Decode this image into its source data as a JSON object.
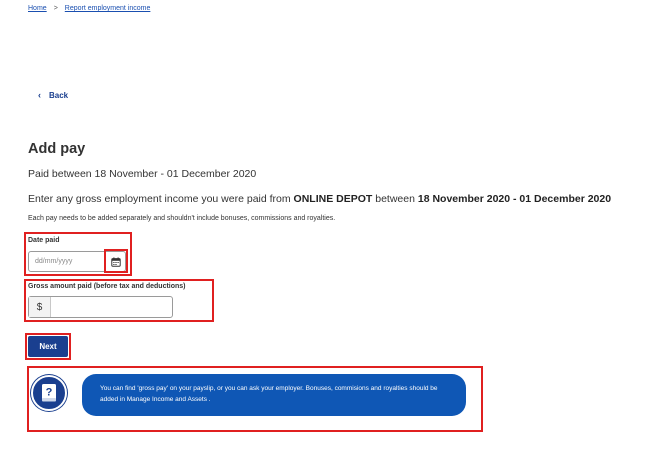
{
  "breadcrumb": {
    "items": [
      {
        "label": "Home"
      },
      {
        "label": "Report employment income"
      }
    ],
    "separator": ">"
  },
  "back": {
    "label": "Back"
  },
  "page": {
    "title": "Add pay",
    "subtitle": "Paid between 18 November - 01 December 2020",
    "intro_prefix": "Enter any gross employment income you were paid from",
    "employer": "ONLINE DEPOT",
    "intro_mid": "between",
    "period": "18 November 2020 - 01 December 2020",
    "note": "Each pay needs to be added separately and shouldn't include bonuses, commissions and royalties."
  },
  "form": {
    "date_paid": {
      "label": "Date paid",
      "value": "",
      "placeholder": "dd/mm/yyyy"
    },
    "gross_amount": {
      "label": "Gross amount paid (before tax and deductions)",
      "currency": "$",
      "value": ""
    },
    "next_label": "Next"
  },
  "help": {
    "text": "You can find 'gross pay' on your payslip, or you can ask your employer. Bonuses, commisions and royalties should be added in Manage Income and Assets ."
  },
  "colors": {
    "link": "#1a4fb0",
    "primary": "#1a3f8f",
    "bubble": "#0f57b5",
    "highlight": "#e02020"
  }
}
